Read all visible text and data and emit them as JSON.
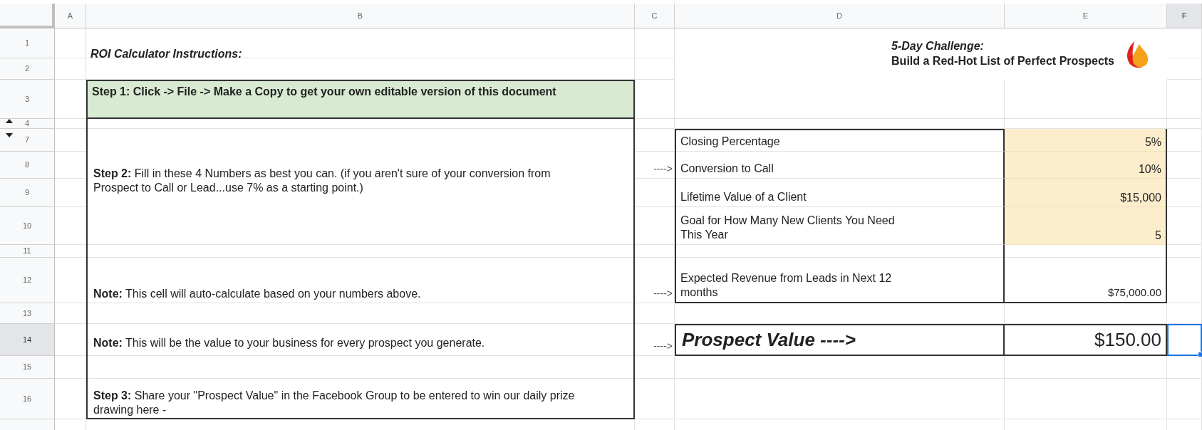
{
  "sheet": {
    "columns": [
      {
        "label": "A",
        "selected": false
      },
      {
        "label": "B",
        "selected": false
      },
      {
        "label": "C",
        "selected": false
      },
      {
        "label": "D",
        "selected": false
      },
      {
        "label": "E",
        "selected": false
      },
      {
        "label": "F",
        "selected": true
      }
    ],
    "rows": [
      {
        "label": "1",
        "selected": false
      },
      {
        "label": "2",
        "selected": false
      },
      {
        "label": "3",
        "selected": false
      },
      {
        "label": "4",
        "selected": false
      },
      {
        "label": "7",
        "selected": false
      },
      {
        "label": "8",
        "selected": false
      },
      {
        "label": "9",
        "selected": false
      },
      {
        "label": "10",
        "selected": false
      },
      {
        "label": "11",
        "selected": false
      },
      {
        "label": "12",
        "selected": false
      },
      {
        "label": "13",
        "selected": false
      },
      {
        "label": "14",
        "selected": true
      },
      {
        "label": "15",
        "selected": false
      },
      {
        "label": "16",
        "selected": false
      }
    ]
  },
  "instructions": {
    "title": "ROI Calculator Instructions:",
    "step_1": "Step 1: Click -> File -> Make a Copy to get your own editable version of this document",
    "step_2": "**Step 2:** Fill in these 4 Numbers as best you can. (if you aren't sure of your conversion from Prospect to Call or Lead...use 7% as a starting point.)",
    "note_1": "**Note:** This cell will auto-calculate based on your numbers above.",
    "note_2": "**Note:** This will be the value to your business for every prospect you generate.",
    "step_3": "**Step 3:** Share your \"Prospect Value\" in the Facebook Group to be entered to win our daily prize drawing here -"
  },
  "challenge": {
    "title": "5-Day Challenge:",
    "subtitle": "Build a Red-Hot List of Perfect Prospects"
  },
  "arrows": [
    "---->",
    "---->",
    "---->"
  ],
  "inputs": [
    {
      "label": "Closing Percentage",
      "value": "5%"
    },
    {
      "label": "Conversion to Call",
      "value": "10%"
    },
    {
      "label": "Lifetime Value of a Client",
      "value": "$15,000"
    },
    {
      "label": "Goal for How Many New Clients You Need This Year",
      "value": "5"
    }
  ],
  "expected_revenue": {
    "label": "Expected Revenue from Leads in Next 12 months",
    "value": "$75,000.00"
  },
  "prospect_value": {
    "label": "Prospect Value ---->",
    "value": "$150.00"
  }
}
